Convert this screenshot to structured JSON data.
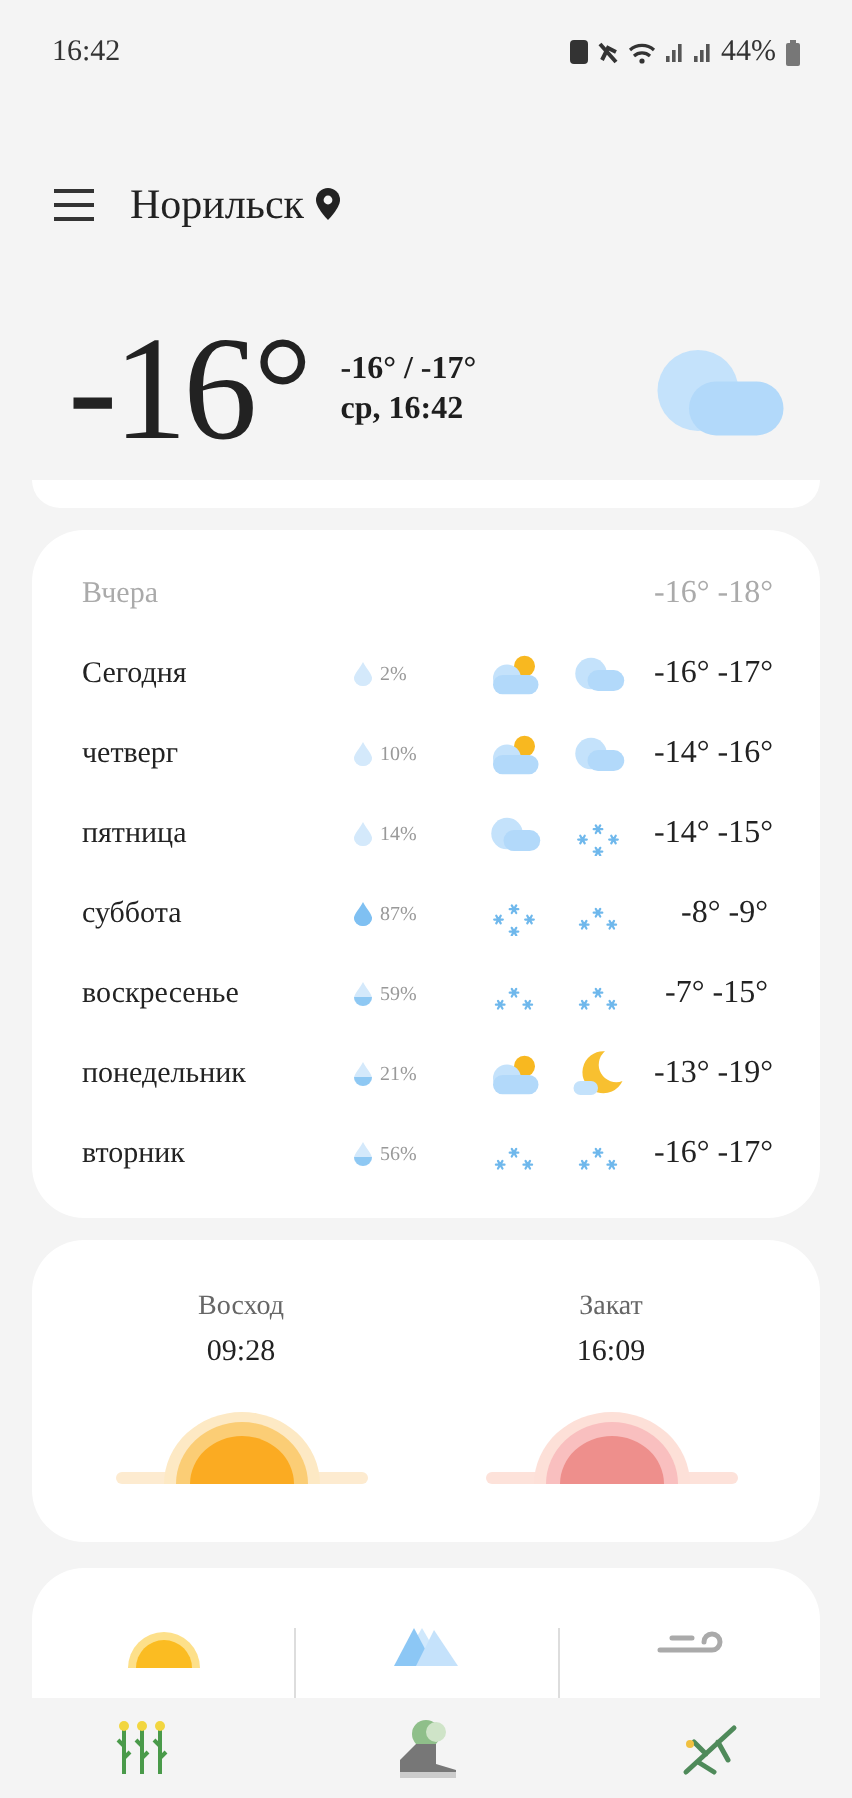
{
  "status_bar": {
    "time": "16:42",
    "battery": "44%"
  },
  "header": {
    "city": "Норильск"
  },
  "current": {
    "temperature": "-16°",
    "range": "-16° / -17°",
    "datetime": "ср, 16:42",
    "kind": "cloudy"
  },
  "forecast": {
    "yesterday": {
      "label": "Вчера",
      "high": "-16°",
      "low": "-18°"
    },
    "days": [
      {
        "day": "Сегодня",
        "precip": {
          "kind": "light",
          "value": "2%"
        },
        "icons": [
          {
            "kind": "partly-cloudy"
          },
          {
            "kind": "cloudy"
          }
        ],
        "high": "-16°",
        "low": "-17°"
      },
      {
        "day": "четверг",
        "precip": {
          "kind": "light",
          "value": "10%"
        },
        "icons": [
          {
            "kind": "partly-cloudy"
          },
          {
            "kind": "cloudy"
          }
        ],
        "high": "-14°",
        "low": "-16°"
      },
      {
        "day": "пятница",
        "precip": {
          "kind": "light",
          "value": "14%"
        },
        "icons": [
          {
            "kind": "cloudy"
          },
          {
            "kind": "snow"
          }
        ],
        "high": "-14°",
        "low": "-15°"
      },
      {
        "day": "суббота",
        "precip": {
          "kind": "full",
          "value": "87%"
        },
        "icons": [
          {
            "kind": "snow"
          },
          {
            "kind": "light-snow"
          }
        ],
        "high": "-8°",
        "low": "-9°"
      },
      {
        "day": "воскресенье",
        "precip": {
          "kind": "half",
          "value": "59%"
        },
        "icons": [
          {
            "kind": "light-snow"
          },
          {
            "kind": "light-snow"
          }
        ],
        "high": "-7°",
        "low": "-15°"
      },
      {
        "day": "понедельник",
        "precip": {
          "kind": "half",
          "value": "21%"
        },
        "icons": [
          {
            "kind": "partly-cloudy"
          },
          {
            "kind": "moon"
          }
        ],
        "high": "-13°",
        "low": "-19°"
      },
      {
        "day": "вторник",
        "precip": {
          "kind": "half",
          "value": "56%"
        },
        "icons": [
          {
            "kind": "light-snow"
          },
          {
            "kind": "light-snow"
          }
        ],
        "high": "-16°",
        "low": "-17°"
      }
    ]
  },
  "sun": [
    {
      "kind": "sunrise",
      "label": "Восход",
      "time": "09:28"
    },
    {
      "kind": "sunset",
      "label": "Закат",
      "time": "16:09"
    }
  ],
  "details": [
    {
      "kind": "uv"
    },
    {
      "kind": "humidity"
    },
    {
      "kind": "wind"
    }
  ],
  "nav": [
    {
      "kind": "flowers",
      "selected": false
    },
    {
      "kind": "shoe",
      "selected": false
    },
    {
      "kind": "sprig",
      "selected": false
    }
  ]
}
